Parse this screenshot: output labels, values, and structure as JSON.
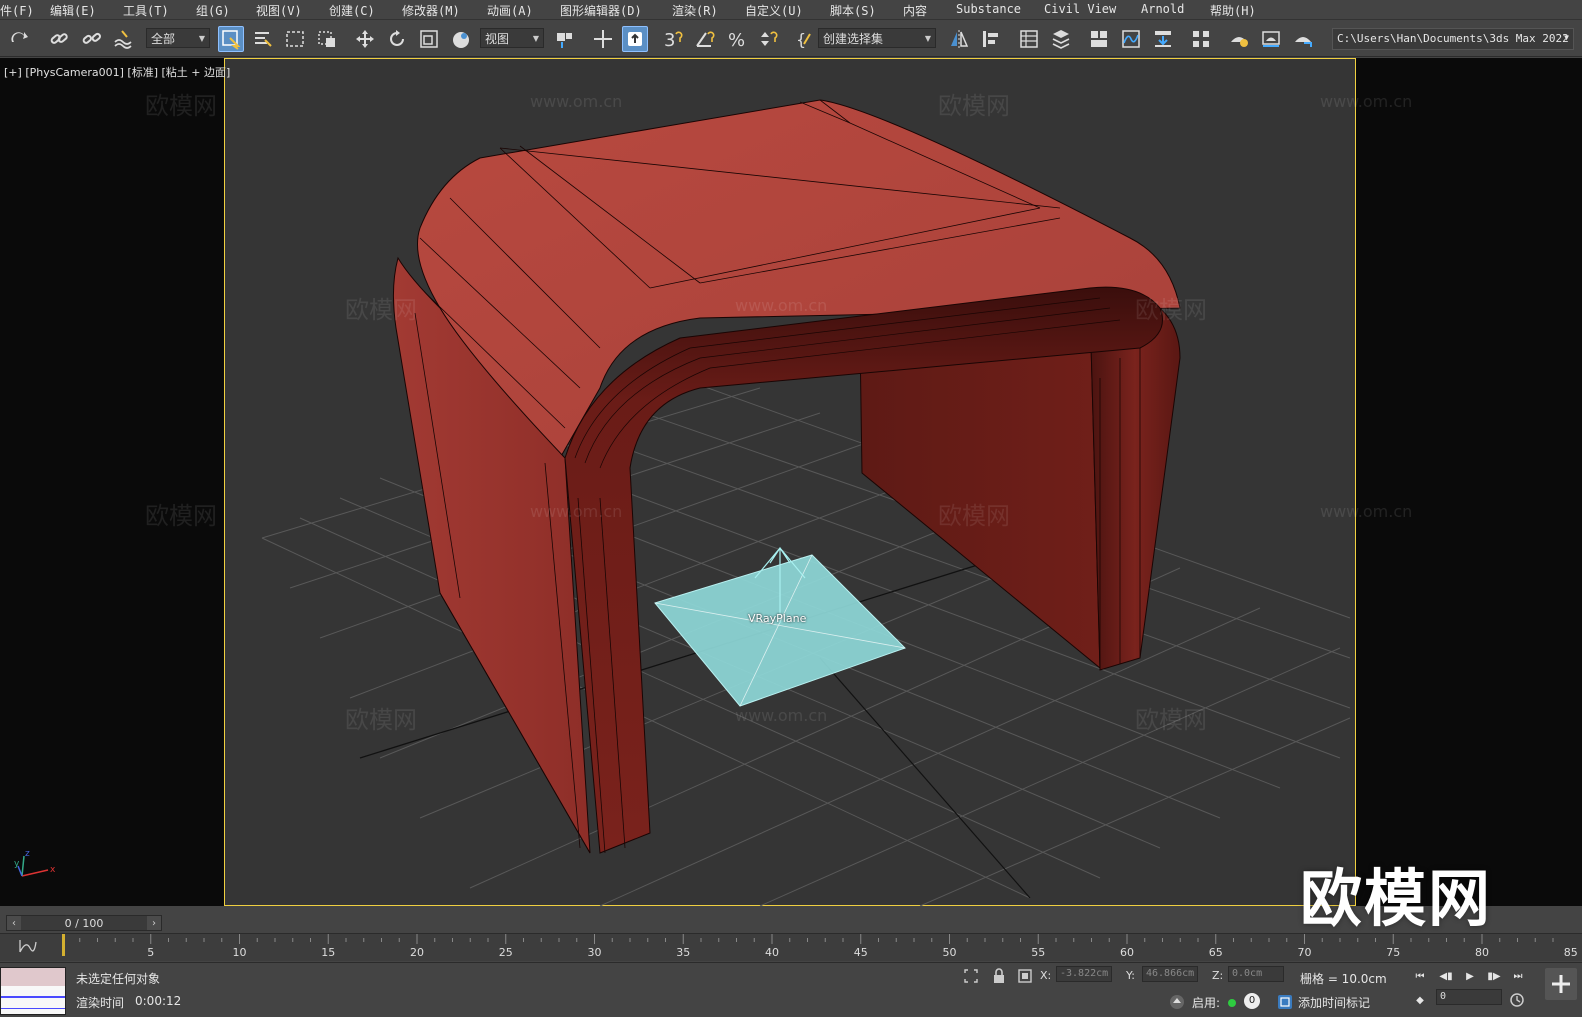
{
  "menu": {
    "items": [
      "文件(F)",
      "编辑(E)",
      "工具(T)",
      "组(G)",
      "视图(V)",
      "创建(C)",
      "修改器(M)",
      "动画(A)",
      "图形编辑器(D)",
      "渲染(R)",
      "自定义(U)",
      "脚本(S)",
      "内容",
      "Substance",
      "Civil View",
      "Arnold",
      "帮助(H)"
    ]
  },
  "toolbar": {
    "selection_filter": "全部",
    "ref_coord": "视图",
    "named_selection": "创建选择集",
    "project_path": "C:\\Users\\Han\\Documents\\3ds Max 2022",
    "snap_value": "3"
  },
  "viewport": {
    "label_plus": "[+]",
    "label_camera": "[PhysCamera001]",
    "label_mode": "[标准]",
    "label_shading": "[粘土 + 边面]",
    "object_label": "VRayPlane",
    "watermark": "欧模网",
    "watermark_url": "www.om.cn",
    "colors": {
      "table": "#b0463c",
      "plane": "#8ed8d8",
      "grid": "#5a5a5a",
      "border": "#f0d040"
    }
  },
  "timeline": {
    "frame_display": "0 / 100",
    "ticks": [
      "0",
      "5",
      "10",
      "15",
      "20",
      "25",
      "30",
      "35",
      "40",
      "45",
      "50",
      "55",
      "60",
      "65",
      "70",
      "75",
      "80",
      "85"
    ]
  },
  "status": {
    "selection": "未选定任何对象",
    "render_time_label": "渲染时间",
    "render_time": "0:00:12",
    "x_label": "X:",
    "x_value": "-3.822cm",
    "y_label": "Y:",
    "y_value": "46.866cm",
    "z_label": "Z:",
    "z_value": "0.0cm",
    "grid_label": "栅格 = 10.0cm",
    "enable_label": "启用:",
    "enable_count": "0",
    "add_time_tag": "添加时间标记",
    "current_frame": "0"
  }
}
